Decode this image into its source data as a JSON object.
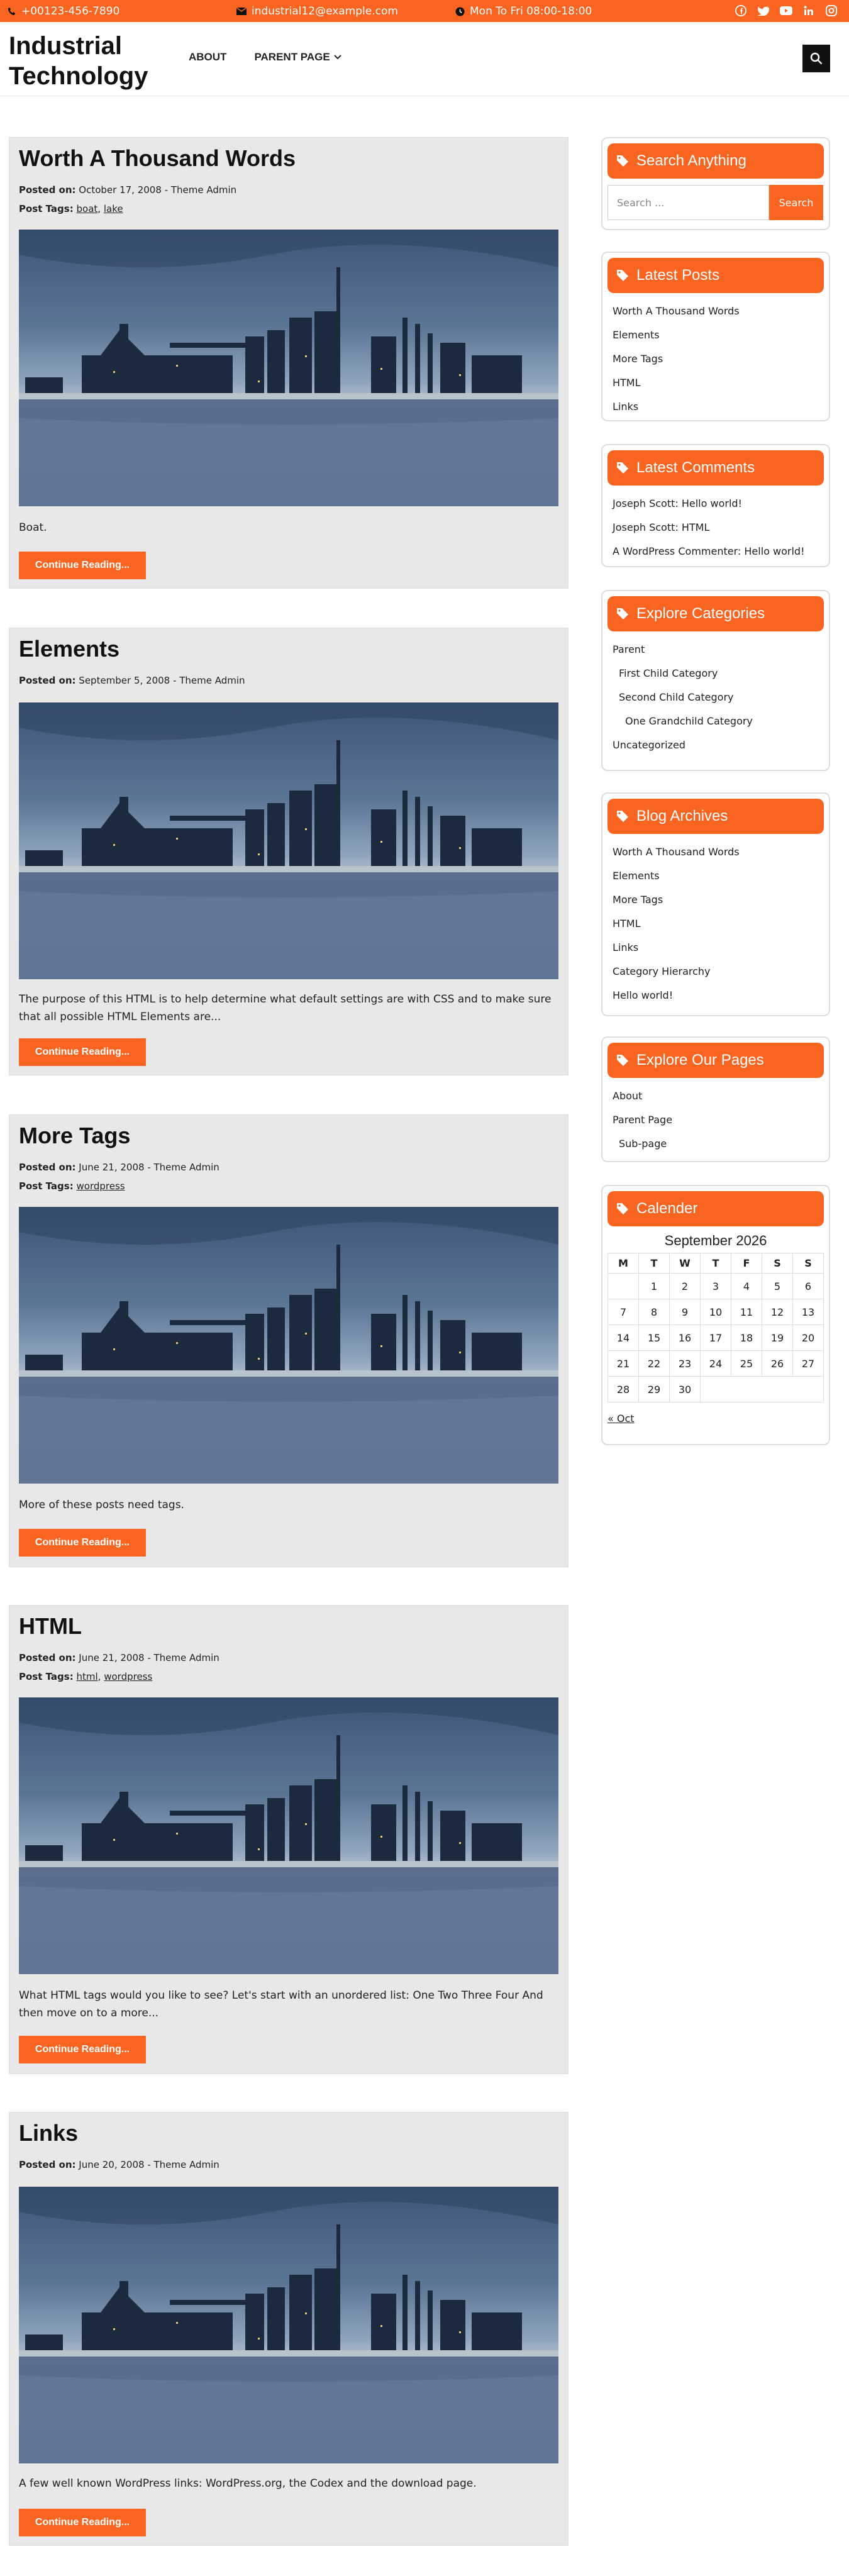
{
  "topbar": {
    "phone": "+00123-456-7890",
    "email": "industrial12@example.com",
    "hours": "Mon To Fri 08:00-18:00",
    "social": [
      "facebook-icon",
      "twitter-icon",
      "youtube-icon",
      "linkedin-icon",
      "instagram-icon"
    ]
  },
  "header": {
    "logo_line1": "Industrial",
    "logo_line2": "Technology",
    "nav": [
      "ABOUT",
      "PARENT PAGE"
    ]
  },
  "posts": [
    {
      "title": "Worth A Thousand Words",
      "posted_label": "Posted on:",
      "date": "October 17, 2008",
      "author": "- Theme Admin",
      "tags_label": "Post Tags:",
      "tags": [
        "boat",
        "lake"
      ],
      "excerpt": "Boat.",
      "cta": "Continue Reading..."
    },
    {
      "title": "Elements",
      "posted_label": "Posted on:",
      "date": "September 5, 2008",
      "author": "- Theme Admin",
      "excerpt": "The purpose of this HTML is to help determine what default settings are with CSS and to make sure that all possible HTML Elements are...",
      "cta": "Continue Reading..."
    },
    {
      "title": "More Tags",
      "posted_label": "Posted on:",
      "date": "June 21, 2008",
      "author": "- Theme Admin",
      "tags_label": "Post Tags:",
      "tags": [
        "wordpress"
      ],
      "excerpt": "More of these posts need tags.",
      "cta": "Continue Reading..."
    },
    {
      "title": "HTML",
      "posted_label": "Posted on:",
      "date": "June 21, 2008",
      "author": "- Theme Admin",
      "tags_label": "Post Tags:",
      "tags": [
        "html",
        "wordpress"
      ],
      "excerpt": "What HTML tags would you like to see? Let's start with an unordered list: One Two Three Four And then move on to a more...",
      "cta": "Continue Reading..."
    },
    {
      "title": "Links",
      "posted_label": "Posted on:",
      "date": "June 20, 2008",
      "author": "- Theme Admin",
      "excerpt": "A few well known WordPress links: WordPress.org, the Codex and the download page.",
      "cta": "Continue Reading..."
    }
  ],
  "sidebar": {
    "search": {
      "title": "Search Anything",
      "placeholder": "Search ...",
      "button": "Search"
    },
    "latest_posts": {
      "title": "Latest Posts",
      "items": [
        "Worth A Thousand Words",
        "Elements",
        "More Tags",
        "HTML",
        "Links"
      ]
    },
    "latest_comments": {
      "title": "Latest Comments",
      "items": [
        {
          "author": "Joseph Scott",
          "sep": ": ",
          "post": "Hello world!"
        },
        {
          "author": "Joseph Scott",
          "sep": ": ",
          "post": "HTML"
        },
        {
          "author": "A WordPress Commenter",
          "sep": ": ",
          "post": "Hello world!"
        }
      ]
    },
    "categories": {
      "title": "Explore Categories",
      "items": [
        "Parent",
        "First Child Category",
        "Second Child Category",
        "One Grandchild Category",
        "Uncategorized"
      ]
    },
    "archives": {
      "title": "Blog Archives",
      "items": [
        "Worth A Thousand Words",
        "Elements",
        "More Tags",
        "HTML",
        "Links",
        "Category Hierarchy",
        "Hello world!"
      ]
    },
    "pages": {
      "title": "Explore Our Pages",
      "items": [
        "About",
        "Parent Page",
        "Sub-page"
      ]
    },
    "calendar": {
      "title": "Calender",
      "month": "September 2026",
      "days": [
        "M",
        "T",
        "W",
        "T",
        "F",
        "S",
        "S"
      ],
      "weeks": [
        [
          "",
          "1",
          "2",
          "3",
          "4",
          "5",
          "6"
        ],
        [
          "7",
          "8",
          "9",
          "10",
          "11",
          "12",
          "13"
        ],
        [
          "14",
          "15",
          "16",
          "17",
          "18",
          "19",
          "20"
        ],
        [
          "21",
          "22",
          "23",
          "24",
          "25",
          "26",
          "27"
        ],
        [
          "28",
          "29",
          "30",
          "",
          "",
          "",
          ""
        ]
      ],
      "prev": "« Oct"
    }
  },
  "colors": {
    "accent": "#f96521",
    "post_bg": "#e8e8e8"
  }
}
